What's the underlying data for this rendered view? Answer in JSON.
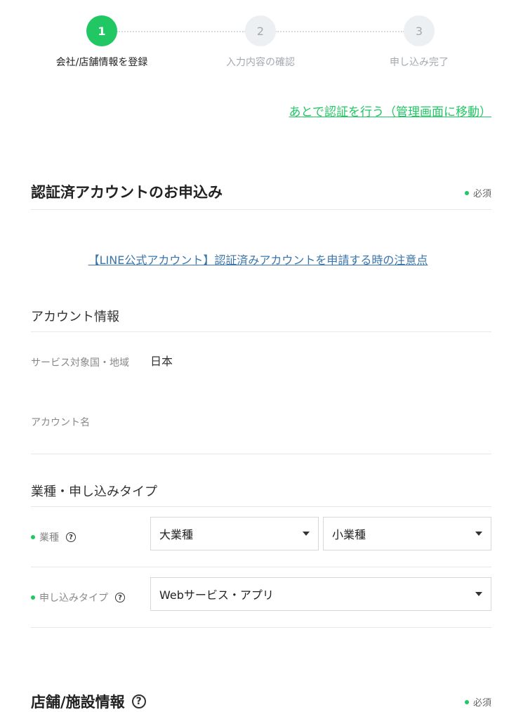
{
  "stepper": {
    "steps": [
      {
        "number": "1",
        "label": "会社/店舗情報を登録"
      },
      {
        "number": "2",
        "label": "入力内容の確認"
      },
      {
        "number": "3",
        "label": "申し込み完了"
      }
    ]
  },
  "later_link": "あとで認証を行う（管理画面に移動）",
  "verified_section": {
    "title": "認証済アカウントのお申込み",
    "required": "必須",
    "notice_link": "【LINE公式アカウント】認証済みアカウントを申請する時の注意点"
  },
  "account_info": {
    "title": "アカウント情報",
    "service_region_label": "サービス対象国・地域",
    "service_region_value": "日本",
    "account_name_label": "アカウント名"
  },
  "industry": {
    "title": "業種・申し込みタイプ",
    "industry_label": "業種",
    "major_select": "大業種",
    "minor_select": "小業種",
    "apply_type_label": "申し込みタイプ",
    "apply_type_select": "Webサービス・アプリ"
  },
  "store_section": {
    "title": "店舗/施設情報",
    "required": "必須"
  },
  "colors": {
    "accent": "#20c763",
    "link": "#3b74a9",
    "inactive_step": "#edf0f3"
  }
}
